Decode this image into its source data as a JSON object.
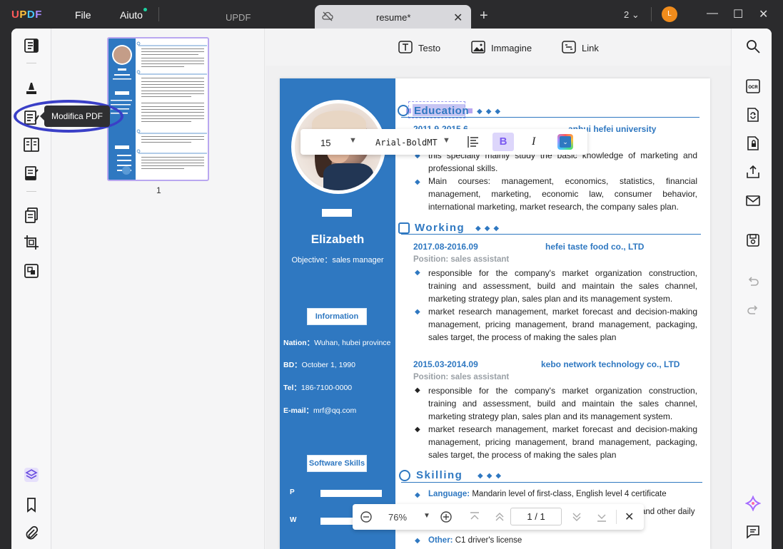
{
  "titlebar": {
    "logo": "UPDF",
    "menu": [
      "File",
      "Aiuto"
    ],
    "inactive_tab": "UPDF",
    "active_tab": "resume*",
    "window_count": "2",
    "avatar_initial": "L"
  },
  "tooltip": "Modifica PDF",
  "thumbnail": {
    "page_number": "1"
  },
  "edit_tools": {
    "text": "Testo",
    "image": "Immagine",
    "link": "Link"
  },
  "format_toolbar": {
    "font_size": "15",
    "font_name": "Arial-BoldMT",
    "bold": "B",
    "italic": "I"
  },
  "resume": {
    "name": "Elizabeth",
    "objective": "Objective：sales manager",
    "information_label": "Information",
    "info": [
      {
        "key": "Nation：",
        "value": "Wuhan, hubei province"
      },
      {
        "key": "BD：",
        "value": "October 1, 1990"
      },
      {
        "key": "Tel：",
        "value": "186-7100-0000"
      },
      {
        "key": "E-mail：",
        "value": "mrf@qq.com"
      }
    ],
    "software_label": "Software Skills",
    "skills_letters": [
      "P",
      "W"
    ],
    "education": {
      "title": "Education",
      "date": "2011.9-2015.6",
      "school": "anhui hefei university",
      "bullets": [
        "this specialty mainly study the basic knowledge of marketing and professional skills.",
        "Main courses: management, economics, statistics, financial management, marketing, economic law, consumer behavior, international marketing, market research, the company sales plan."
      ]
    },
    "working": {
      "title": "Working",
      "jobs": [
        {
          "date": "2017.08-2016.09",
          "company": "hefei taste food co., LTD",
          "position": "Position: sales assistant",
          "bullets": [
            "responsible for the company's market organization construction, training and assessment, build and maintain the sales channel, marketing strategy plan, sales plan and its management system.",
            "market research management, market forecast and decision-making management, pricing management, brand management, packaging, sales target, the process of making the sales plan"
          ]
        },
        {
          "date": "2015.03-2014.09",
          "company": "kebo network technology co., LTD",
          "position": "Position: sales assistant",
          "bullets": [
            "responsible for the company's market organization construction, training and assessment, build and maintain the sales channel, marketing strategy plan, sales plan and its management system.",
            "market research management, market forecast and decision-making management, pricing management, brand management, packaging, sales target, the process of making the sales plan"
          ]
        }
      ]
    },
    "skilling": {
      "title": "Skilling",
      "language_label": "Language:",
      "language_value": "Mandarin level of first-class, English level 4 certificate",
      "partial_line": "and other daily",
      "other_label": "Other:",
      "other_value": "C1 driver's license"
    }
  },
  "zoom": {
    "value": "76%",
    "page_current": "1",
    "page_sep": "/",
    "page_total": "1"
  },
  "colors": {
    "accent": "#2f78c1",
    "selection": "#c7c5f3",
    "ring": "#3a3fc7",
    "avatar": "#f08c1c"
  }
}
